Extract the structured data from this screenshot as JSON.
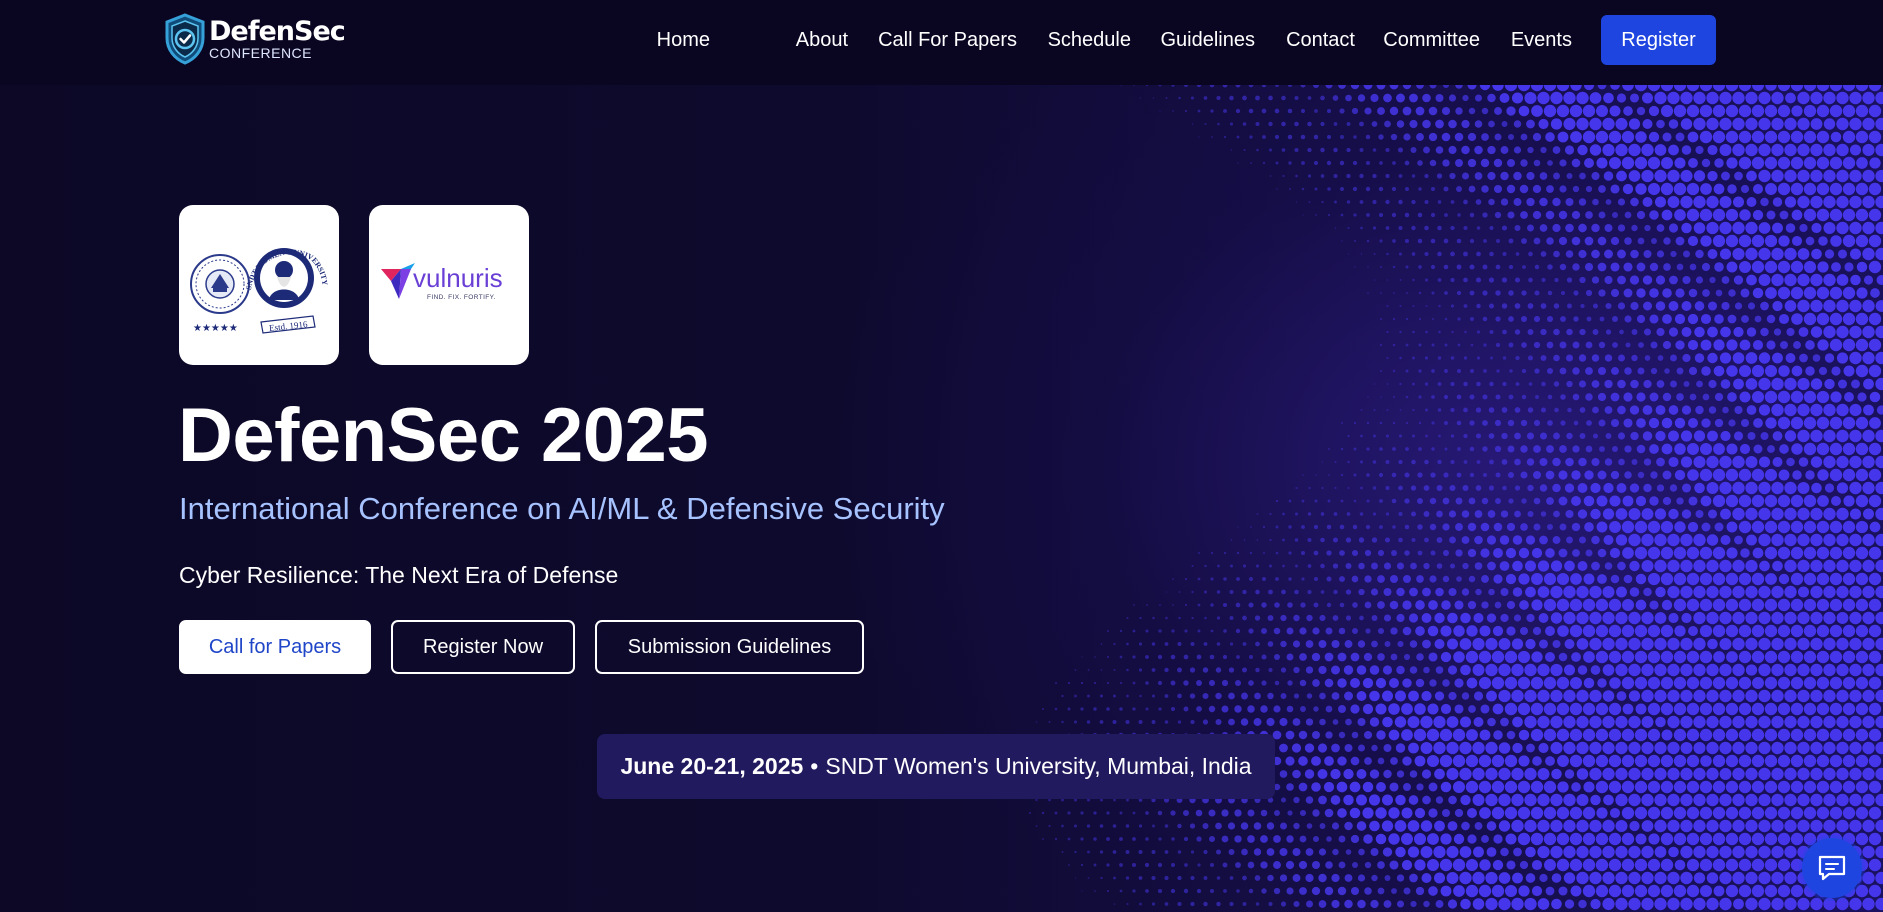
{
  "brand": {
    "name": "DefenSec",
    "sub": "CONFERENCE",
    "icon": "shield-check-icon"
  },
  "nav": {
    "items": [
      {
        "label": "Home"
      },
      {
        "label": "About"
      },
      {
        "label": "Call For Papers"
      },
      {
        "label": "Schedule"
      },
      {
        "label": "Guidelines"
      },
      {
        "label": "Contact"
      },
      {
        "label": "Committee"
      },
      {
        "label": "Events"
      }
    ],
    "register_label": "Register"
  },
  "hero": {
    "logos": {
      "sndt": {
        "arc_text": "SNDT WOMEN'S UNIVERSITY",
        "estd": "Estd. 1916"
      },
      "vulnuris": {
        "name": "vulnuris",
        "tagline": "FIND. FIX. FORTIFY."
      }
    },
    "title": "DefenSec 2025",
    "subtitle": "International Conference on AI/ML & Defensive Security",
    "theme": "Cyber Resilience: The Next Era of Defense",
    "buttons": {
      "call_for_papers": "Call for Papers",
      "register_now": "Register Now",
      "submission_guidelines": "Submission Guidelines"
    },
    "info": {
      "date": "June 20-21, 2025",
      "separator": "•",
      "venue": "SNDT Women's University, Mumbai, India"
    }
  },
  "chat": {
    "icon": "chat-bubble-icon"
  },
  "colors": {
    "background": "#0c0826",
    "accent_blue": "#1f45e0",
    "subtitle": "#a6c2ff",
    "info_pill": "#221a5e"
  }
}
